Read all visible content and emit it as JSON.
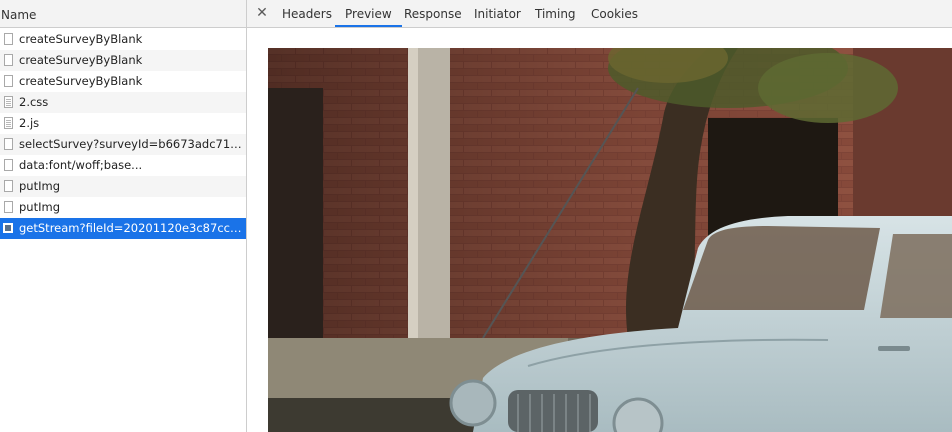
{
  "request_list": {
    "header": {
      "name_label": "Name"
    },
    "rows": [
      {
        "label": "createSurveyByBlank",
        "icon": "document-icon"
      },
      {
        "label": "createSurveyByBlank",
        "icon": "document-icon"
      },
      {
        "label": "createSurveyByBlank",
        "icon": "document-icon"
      },
      {
        "label": "2.css",
        "icon": "stylesheet-file-icon"
      },
      {
        "label": "2.js",
        "icon": "script-file-icon"
      },
      {
        "label": "selectSurvey?surveyId=b6673adc710e4c...",
        "icon": "document-icon"
      },
      {
        "label": "data:font/woff;base...",
        "icon": "document-icon"
      },
      {
        "label": "putImg",
        "icon": "document-icon"
      },
      {
        "label": "putImg",
        "icon": "document-icon"
      },
      {
        "label": "getStream?fileId=20201120e3c87cc2d5...",
        "icon": "image-file-icon",
        "selected": true
      }
    ]
  },
  "detail": {
    "close_icon": "close-icon",
    "tabs": [
      {
        "label": "Headers"
      },
      {
        "label": "Preview",
        "active": true
      },
      {
        "label": "Response"
      },
      {
        "label": "Initiator"
      },
      {
        "label": "Timing"
      },
      {
        "label": "Cookies"
      }
    ]
  },
  "colors": {
    "selection": "#1a73e8",
    "active_tab_underline": "#1a73e8",
    "panel_header_bg": "#f3f3f3",
    "border": "#cdcdcd"
  }
}
